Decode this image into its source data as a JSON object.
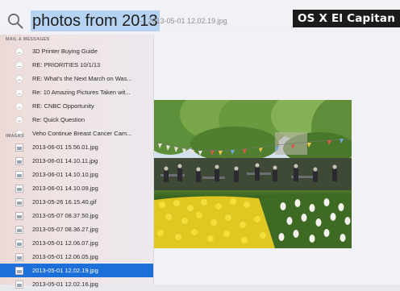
{
  "badge": "OS X El Capitan",
  "search": {
    "query": "photos from 2013",
    "hint": "— 2013-05-01 12.02.19.jpg"
  },
  "sections": {
    "mail": "MAIL & MESSAGES",
    "images": "IMAGES"
  },
  "mail_items": [
    {
      "label": "3D Printer Buying Guide",
      "icon": "mail-icon"
    },
    {
      "label": "RE: PRIORITIES 10/1/13",
      "icon": "mail-icon"
    },
    {
      "label": "RE: What's the Next March on Was...",
      "icon": "mail-icon"
    },
    {
      "label": "Re: 10 Amazing Pictures Taken wit...",
      "icon": "mail-icon"
    },
    {
      "label": "RE: CNBC Opportunity",
      "icon": "mail-icon"
    },
    {
      "label": "Re: Quick Question",
      "icon": "mail-icon"
    },
    {
      "label": "Veho Continue Breast Cancer Cam...",
      "icon": "mail-icon"
    }
  ],
  "image_items": [
    {
      "label": "2013-06-01 15.56.01.jpg",
      "icon": "image-file-icon",
      "selected": false
    },
    {
      "label": "2013-06-01 14.10.11.jpg",
      "icon": "image-file-icon",
      "selected": false
    },
    {
      "label": "2013-06-01 14.10.10.jpg",
      "icon": "image-file-icon",
      "selected": false
    },
    {
      "label": "2013-06-01 14.10.09.jpg",
      "icon": "image-file-icon",
      "selected": false
    },
    {
      "label": "2013-05-26 16.15.40.gif",
      "icon": "image-file-icon",
      "selected": false
    },
    {
      "label": "2013-05-07 08.37.50.jpg",
      "icon": "image-file-icon",
      "selected": false
    },
    {
      "label": "2013-05-07 08.36.27.jpg",
      "icon": "image-file-icon",
      "selected": false
    },
    {
      "label": "2013-05-01 12.06.07.jpg",
      "icon": "image-file-icon",
      "selected": false
    },
    {
      "label": "2013-05-01 12.06.05.jpg",
      "icon": "image-file-icon",
      "selected": false
    },
    {
      "label": "2013-05-01 12.02.19.jpg",
      "icon": "image-file-icon",
      "selected": true
    },
    {
      "label": "2013-05-01 12.02.16.jpg",
      "icon": "image-file-icon",
      "selected": false
    }
  ],
  "colors": {
    "selection": "#1c6fd9",
    "query_highlight": "#b6d3f3",
    "badge_bg": "#1b1b1b"
  }
}
